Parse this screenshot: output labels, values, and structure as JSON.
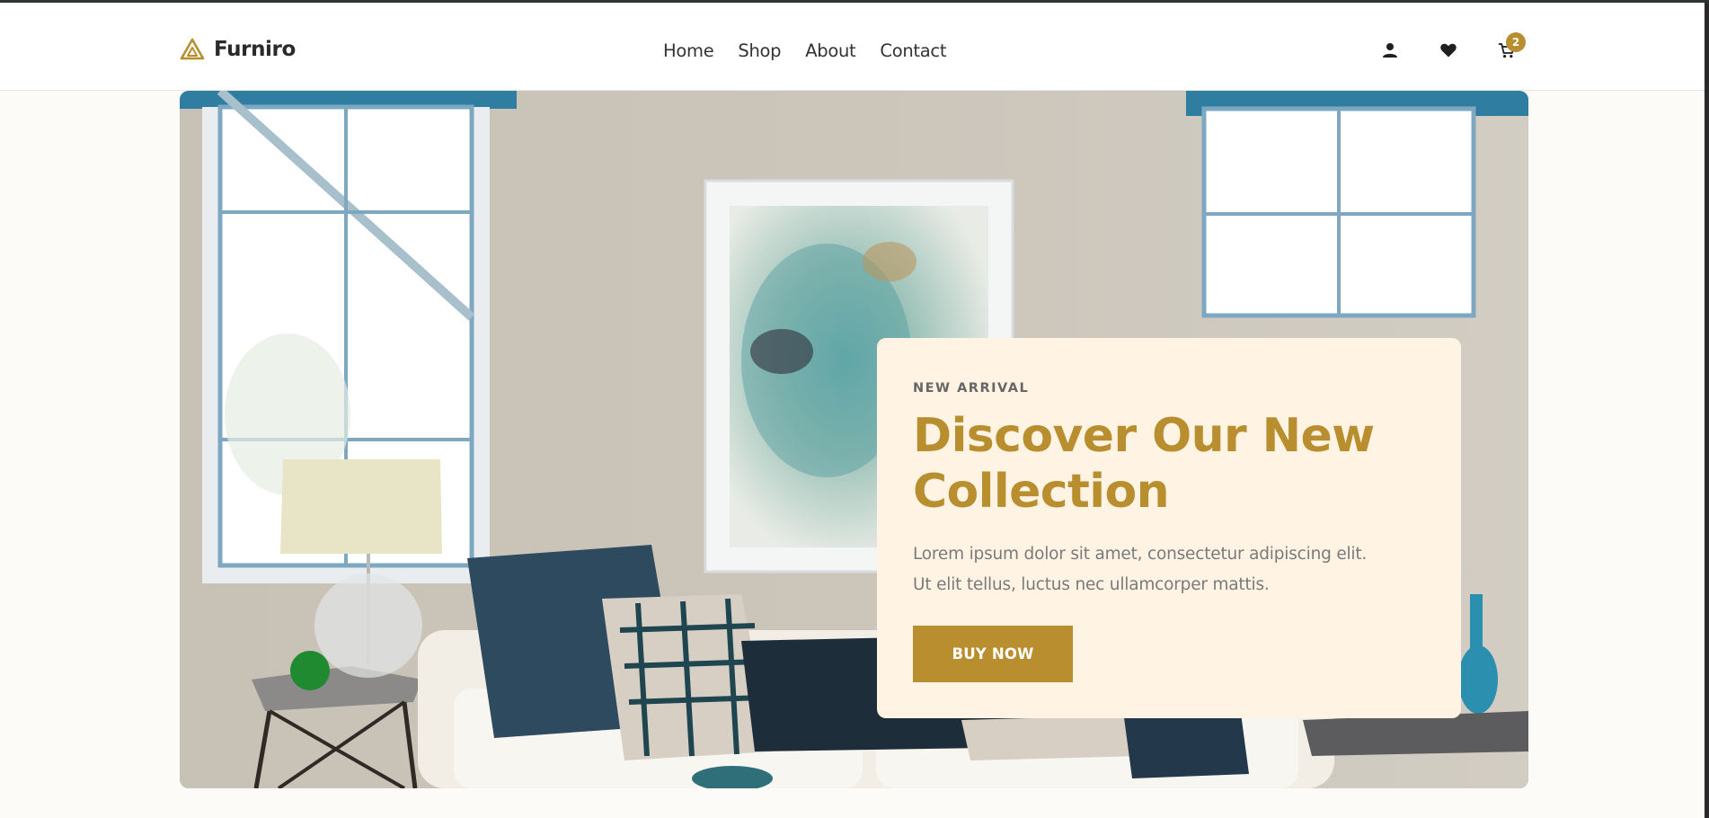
{
  "brand": {
    "name": "Furniro",
    "logo_icon": "triangle-logo-icon",
    "accent_color": "#b88e2f"
  },
  "nav": {
    "items": [
      {
        "label": "Home"
      },
      {
        "label": "Shop"
      },
      {
        "label": "About"
      },
      {
        "label": "Contact"
      }
    ]
  },
  "header_actions": {
    "account_icon": "user-icon",
    "wishlist_icon": "heart-icon",
    "cart_icon": "cart-icon",
    "cart_count": "2"
  },
  "hero": {
    "image": "living-room-photo",
    "card": {
      "eyebrow": "NEW ARRIVAL",
      "headline_line1": "Discover Our New",
      "headline_line2": "Collection",
      "body_line1": "Lorem ipsum dolor sit amet, consectetur adipiscing elit.",
      "body_line2": "Ut elit tellus, luctus nec ullamcorper mattis.",
      "cta_label": "BUY NOW",
      "background_color": "#fff3e3"
    }
  }
}
